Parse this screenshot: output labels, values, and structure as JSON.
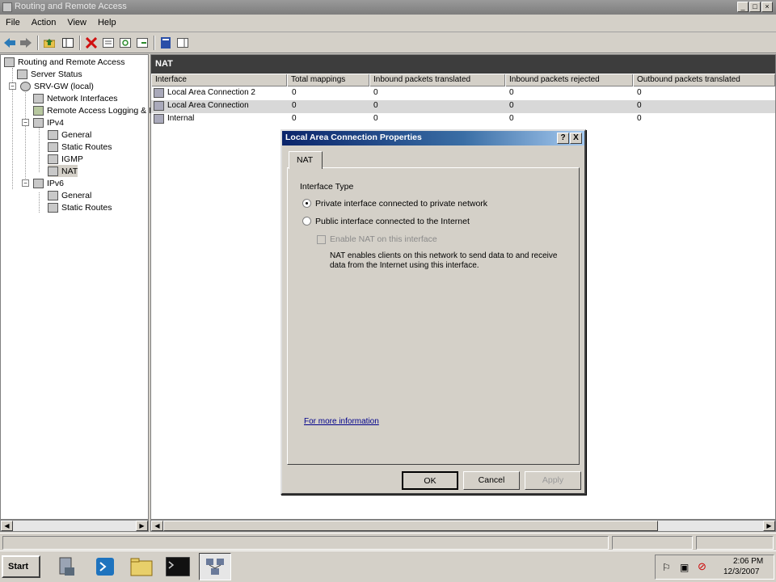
{
  "window": {
    "title": "Routing and Remote Access"
  },
  "menu": [
    "File",
    "Action",
    "View",
    "Help"
  ],
  "tree": {
    "root": "Routing and Remote Access",
    "server_status": "Server Status",
    "server": "SRV-GW (local)",
    "network_interfaces": "Network Interfaces",
    "remote_access_logging": "Remote Access Logging & I",
    "ipv4": "IPv4",
    "ipv4_children": [
      "General",
      "Static Routes",
      "IGMP",
      "NAT"
    ],
    "ipv6": "IPv6",
    "ipv6_children": [
      "General",
      "Static Routes"
    ]
  },
  "panel": {
    "title": "NAT",
    "columns": [
      "Interface",
      "Total mappings",
      "Inbound packets translated",
      "Inbound packets rejected",
      "Outbound packets translated"
    ],
    "rows": [
      {
        "interface": "Local Area Connection 2",
        "total": "0",
        "in_trans": "0",
        "in_rej": "0",
        "out_trans": "0"
      },
      {
        "interface": "Local Area Connection",
        "total": "0",
        "in_trans": "0",
        "in_rej": "0",
        "out_trans": "0"
      },
      {
        "interface": "Internal",
        "total": "0",
        "in_trans": "0",
        "in_rej": "0",
        "out_trans": "0"
      }
    ]
  },
  "dialog": {
    "title": "Local Area Connection Properties",
    "help_label": "?",
    "close_label": "X",
    "tab": "NAT",
    "group_label": "Interface Type",
    "option_private": "Private interface connected to private network",
    "option_public": "Public interface connected to the Internet",
    "checkbox_label": "Enable NAT on this interface",
    "description_line1": "NAT enables clients on this network to send data to and receive",
    "description_line2": "data from the Internet using this interface.",
    "more_info_link": "For more information",
    "ok": "OK",
    "cancel": "Cancel",
    "apply": "Apply",
    "selected_option": "private"
  },
  "taskbar": {
    "start": "Start",
    "time": "2:06 PM",
    "date": "12/3/2007"
  },
  "colors": {
    "dialog_title_start": "#0a246a",
    "dialog_title_end": "#a6caf0",
    "panel_header": "#3d3d3d",
    "link": "#00008b"
  }
}
